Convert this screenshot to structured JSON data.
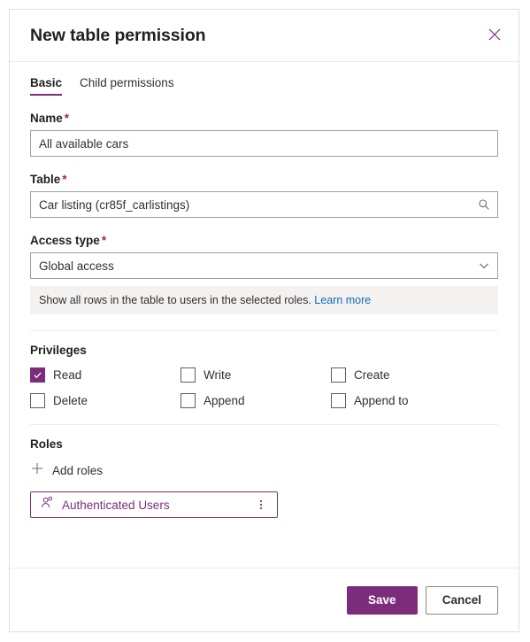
{
  "dialog": {
    "title": "New table permission",
    "close_icon": "close-icon"
  },
  "tabs": [
    {
      "label": "Basic",
      "active": true
    },
    {
      "label": "Child permissions",
      "active": false
    }
  ],
  "form": {
    "name": {
      "label": "Name",
      "required_marker": "*",
      "value": "All available cars"
    },
    "table": {
      "label": "Table",
      "required_marker": "*",
      "value": "Car listing (cr85f_carlistings)",
      "icon": "search-icon"
    },
    "access_type": {
      "label": "Access type",
      "required_marker": "*",
      "value": "Global access",
      "icon": "chevron-down-icon",
      "hint_text": "Show all rows in the table to users in the selected roles.",
      "hint_link": "Learn more"
    }
  },
  "privileges": {
    "label": "Privileges",
    "items": [
      {
        "label": "Read",
        "checked": true
      },
      {
        "label": "Write",
        "checked": false
      },
      {
        "label": "Create",
        "checked": false
      },
      {
        "label": "Delete",
        "checked": false
      },
      {
        "label": "Append",
        "checked": false
      },
      {
        "label": "Append to",
        "checked": false
      }
    ]
  },
  "roles": {
    "label": "Roles",
    "add_label": "Add roles",
    "add_icon": "plus-icon",
    "items": [
      {
        "name": "Authenticated Users",
        "icon": "contact-icon",
        "menu_icon": "more-vertical-icon"
      }
    ]
  },
  "footer": {
    "save_label": "Save",
    "cancel_label": "Cancel"
  },
  "colors": {
    "accent": "#7b2d7b",
    "required": "#a4262c",
    "link": "#0f6cbd",
    "info_bg": "#f3f2f1"
  }
}
